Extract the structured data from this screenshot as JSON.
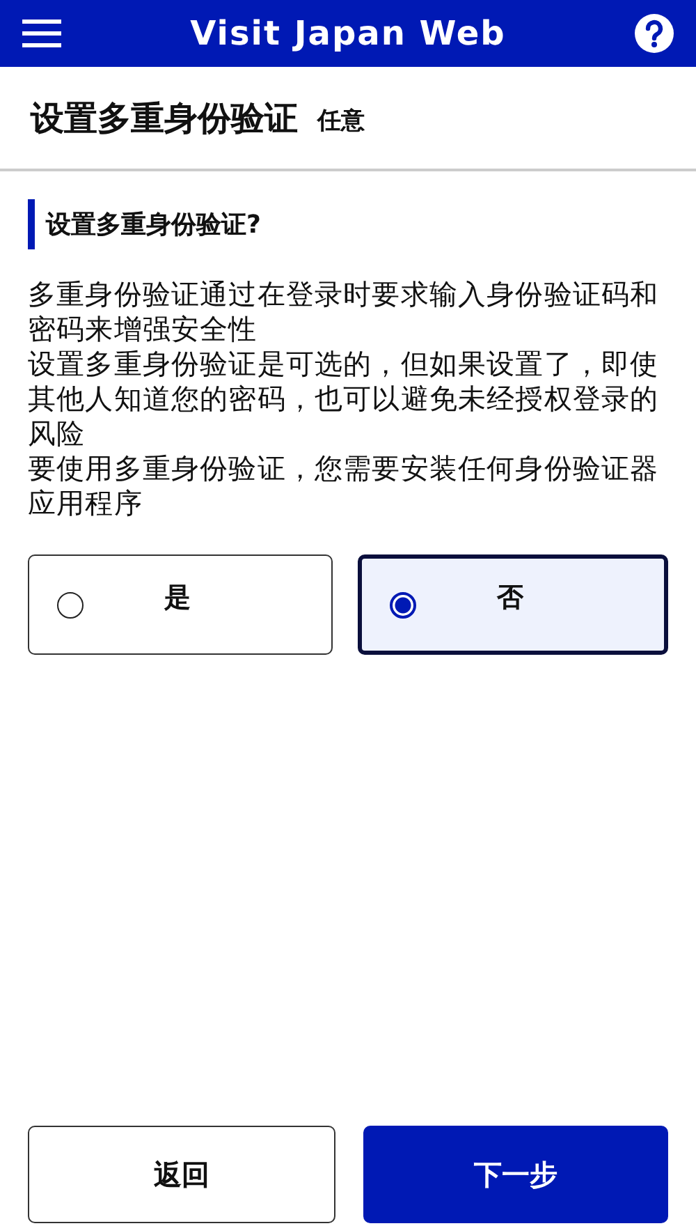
{
  "header": {
    "title": "Visit Japan Web"
  },
  "page": {
    "title": "设置多重身份验证",
    "tag": "任意"
  },
  "question": "设置多重身份验证?",
  "paragraphs": [
    "多重身份验证通过在登录时要求输入身份验证码和密码来增强安全性",
    "设置多重身份验证是可选的，但如果设置了，即使其他人知道您的密码，也可以避免未经授权登录的风险",
    "要使用多重身份验证，您需要安装任何身份验证器应用程序"
  ],
  "options": [
    {
      "label": "是",
      "selected": false
    },
    {
      "label": "否",
      "selected": true
    }
  ],
  "buttons": {
    "back": "返回",
    "next": "下一步"
  }
}
